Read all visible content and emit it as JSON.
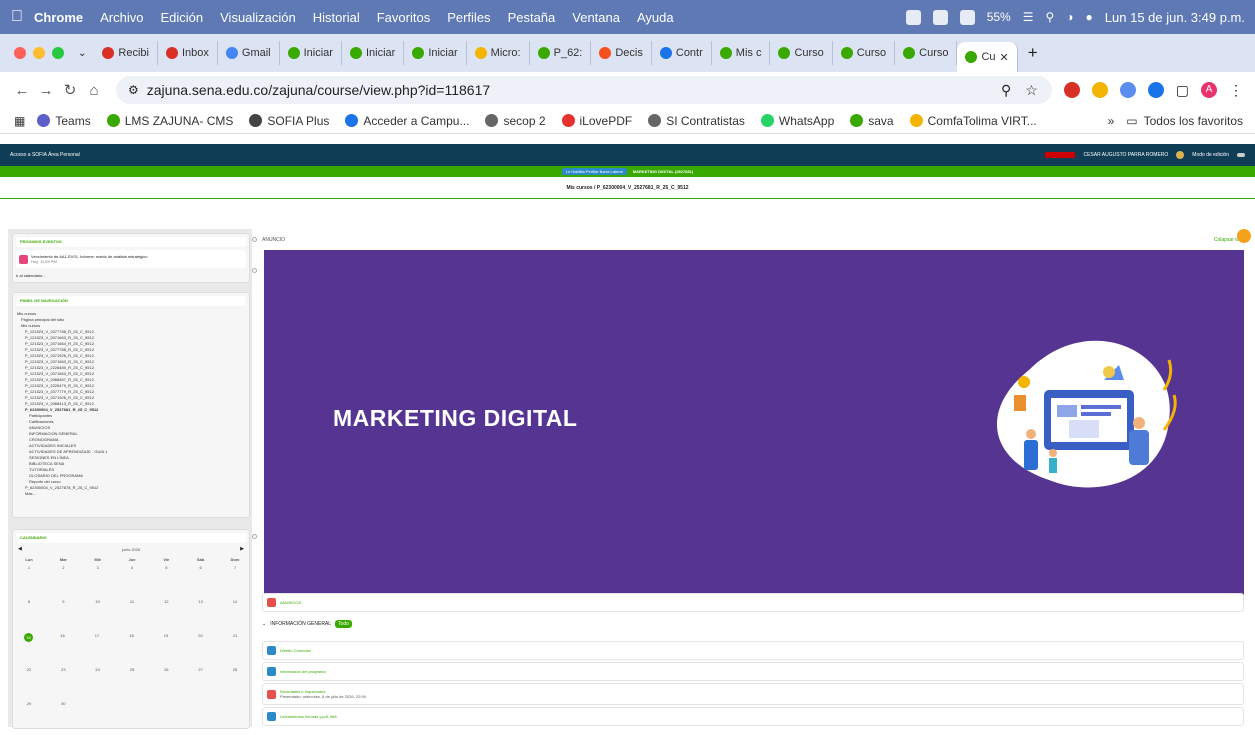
{
  "menubar": {
    "app": "Chrome",
    "items": [
      "Archivo",
      "Edición",
      "Visualización",
      "Historial",
      "Favoritos",
      "Perfiles",
      "Pestaña",
      "Ventana",
      "Ayuda"
    ],
    "battery": "55%",
    "datetime": "Lun 15 de jun.  3:49 p.m."
  },
  "tabs": [
    {
      "label": "Recibi",
      "color": "#d93025"
    },
    {
      "label": "Inbox",
      "color": "#d93025"
    },
    {
      "label": "Gmail",
      "color": "#4285f4"
    },
    {
      "label": "Iniciar",
      "color": "#39a900"
    },
    {
      "label": "Iniciar",
      "color": "#39a900"
    },
    {
      "label": "Iniciar",
      "color": "#39a900"
    },
    {
      "label": "Micro:",
      "color": "#f4b400"
    },
    {
      "label": "P_62:",
      "color": "#39a900"
    },
    {
      "label": "Decis",
      "color": "#f4511e"
    },
    {
      "label": "Contr",
      "color": "#1a73e8"
    },
    {
      "label": "Mis c",
      "color": "#39a900"
    },
    {
      "label": "Curso",
      "color": "#39a900"
    },
    {
      "label": "Curso",
      "color": "#39a900"
    },
    {
      "label": "Curso",
      "color": "#39a900"
    }
  ],
  "active_tab": {
    "label": "Cu"
  },
  "address": {
    "url": "zajuna.sena.edu.co/zajuna/course/view.php?id=118617"
  },
  "bookmarks": [
    {
      "label": "Teams",
      "color": "#5b5fc7"
    },
    {
      "label": "LMS ZAJUNA- CMS",
      "color": "#39a900"
    },
    {
      "label": "SOFIA Plus",
      "color": "#444"
    },
    {
      "label": "Acceder a Campu...",
      "color": "#1a73e8"
    },
    {
      "label": "secop 2",
      "color": "#666"
    },
    {
      "label": "iLovePDF",
      "color": "#e5322d"
    },
    {
      "label": "SI Contratistas",
      "color": "#666"
    },
    {
      "label": "WhatsApp",
      "color": "#25d366"
    },
    {
      "label": "sava",
      "color": "#39a900"
    },
    {
      "label": "ComfaTolima VIRT...",
      "color": "#f4b400"
    }
  ],
  "all_bookmarks": "Todos los favoritos",
  "lms": {
    "header_left": "Acceso a SOFIA   Área Personal",
    "header_user": "CESAR AUGUSTO PARRA ROMERO",
    "header_edit": "Modo de edición",
    "green_chip": "Le Habilita Perfilar Barra Lateral",
    "green_title": "MARKETING DIGITAL (2527681)",
    "breadcrumb": "Mis cursos / P_62300004_V_2527681_R_25_C_9512",
    "upcoming_title": "PRÓXIMOS EVENTOS",
    "upcoming_event": "Vencimiento de AA1-EV01. Informe: matriz de análisis estratégico",
    "upcoming_time": "Hoy, 11:59 PM",
    "go_calendar": "Ir al calendario...",
    "nav_title": "PANEL DE NAVEGACIÓN",
    "tree": [
      "Mis cursos",
      "Página principal del sitio",
      "Mis cursos",
      "P_121523_V_2077788_R_25_C_9512",
      "P_121523_V_2071663_R_25_C_9512",
      "P_121523_V_2071664_R_25_C_9512",
      "P_121523_V_2077788_R_25_C_9512",
      "P_121523_V_2071926_R_25_C_9512",
      "P_121523_V_2071663_R_25_C_9512",
      "P_121523_V_2226480_R_25_C_9512",
      "P_121523_V_2071663_R_25_C_9512",
      "P_121523_V_2068467_R_25_C_9512",
      "P_121523_V_2226479_R_25_C_9512",
      "P_121523_V_2077779_R_25_C_9512",
      "P_121523_V_2071926_R_25_C_9512",
      "P_121523_V_2068413_R_25_C_9512",
      "P_62300004_V_2527681_R_25_C_9512",
      "Participantes",
      "Calificaciones",
      "ANUNCIOS",
      "INFORMACIÓN GENERAL",
      "CRONOGRAMA",
      "ACTIVIDADES INICIALES",
      "ACTIVIDADES DE APRENDIZAJE - GUIA 1",
      "SESIONES EN LÍNEA",
      "BIBLIOTECA SENA",
      "TUTORIALES",
      "GLOSARIO DEL PROGRAMA",
      "Reporte del curso",
      "P_62300004_V_2527678_R_25_C_9512",
      "Más..."
    ],
    "calendar_title": "CALENDARIO",
    "calendar_month": "junio 2026",
    "weekdays": [
      "Lun",
      "Mar",
      "Mié",
      "Jue",
      "Vie",
      "Sáb",
      "Dom"
    ],
    "weeks": [
      [
        "1",
        "2",
        "3",
        "4",
        "5",
        "6",
        "7"
      ],
      [
        "8",
        "9",
        "10",
        "11",
        "12",
        "13",
        "14"
      ],
      [
        "15",
        "16",
        "17",
        "18",
        "19",
        "20",
        "21"
      ],
      [
        "22",
        "23",
        "24",
        "25",
        "26",
        "27",
        "28"
      ],
      [
        "29",
        "30",
        "",
        "",
        "",
        "",
        ""
      ]
    ],
    "anuncio": "ANUNCIO",
    "collapse_all": "Colapsar todo",
    "banner_title": "MARKETING DIGITAL",
    "anuncios_link": "ANUNCIOS",
    "section_title": "INFORMACIÓN GENERAL",
    "section_badge": "Todo",
    "activities": [
      {
        "label": "Diseño Curricular",
        "color": "#2b8bc9"
      },
      {
        "label": "Información del programa",
        "color": "#2b8bc9"
      },
      {
        "label": "Novedades e Inquietudes",
        "color": "#e6504b"
      },
      {
        "label": "Lineamientos normas y.pdf, 968",
        "color": "#2b8bc9"
      }
    ],
    "novedades_due": "Presentado: miércoles, 8 de julio de 2026, 22:59"
  }
}
